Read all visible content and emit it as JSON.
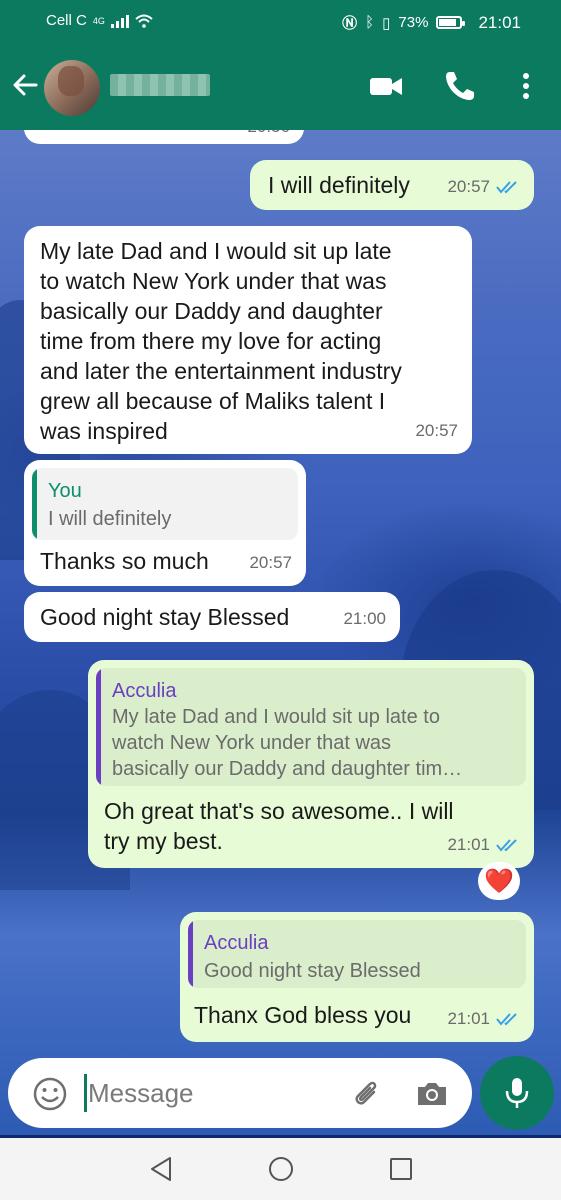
{
  "status_bar": {
    "carrier": "Cell C",
    "network": "4G",
    "battery": "73%",
    "time": "21:01"
  },
  "header": {
    "contact_name": "",
    "icons": [
      "back-arrow-icon",
      "avatar",
      "video-call-icon",
      "voice-call-icon",
      "more-options-icon"
    ]
  },
  "colors": {
    "header_green": "#0c7a5f",
    "incoming_bubble": "#ffffff",
    "outgoing_bubble": "#e7fbd6",
    "read_ticks": "#3aa0e6",
    "quote_you": "#0c8f6a",
    "quote_acculia": "#6a3fc1"
  },
  "messages": [
    {
      "direction": "in",
      "text": "",
      "time": "20:56"
    },
    {
      "direction": "out",
      "text": "I will definitely",
      "time": "20:57",
      "status": "read"
    },
    {
      "direction": "in",
      "lines": [
        "My late Dad and I would sit up late",
        "to watch New York under that was",
        "basically our Daddy and daughter",
        "time from there my love for acting",
        "and later the entertainment industry",
        "grew all because of Maliks talent I",
        "was inspired"
      ],
      "time": "20:57"
    },
    {
      "direction": "in",
      "quote": {
        "author": "You",
        "text": "I will definitely"
      },
      "text": "Thanks so much",
      "time": "20:57"
    },
    {
      "direction": "in",
      "text": "Good night stay Blessed",
      "time": "21:00"
    },
    {
      "direction": "out",
      "quote": {
        "author": "Acculia",
        "lines": [
          "My late Dad and I would sit up late to",
          "watch New York under that was",
          "basically our Daddy and daughter tim…"
        ]
      },
      "lines": [
        "Oh great that's so awesome.. I will",
        "try my best."
      ],
      "time": "21:01",
      "status": "read",
      "reaction": "❤️"
    },
    {
      "direction": "out",
      "quote": {
        "author": "Acculia",
        "text": "Good night stay Blessed"
      },
      "text": "Thanx God bless you",
      "time": "21:01",
      "status": "read"
    }
  ],
  "composer": {
    "placeholder": "Message"
  }
}
